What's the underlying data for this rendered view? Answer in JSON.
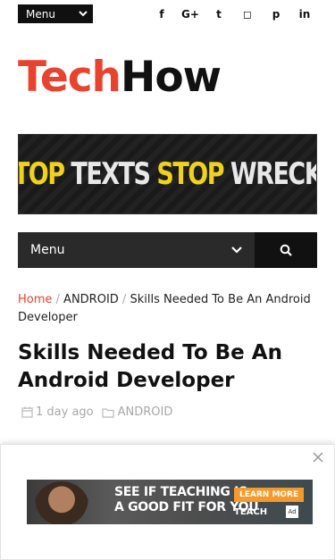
{
  "top_menu": {
    "label": "Menu"
  },
  "social": [
    {
      "icon": "facebook-icon",
      "glyph": "f"
    },
    {
      "icon": "google-plus-icon",
      "glyph": "G+"
    },
    {
      "icon": "twitter-icon",
      "glyph": "t"
    },
    {
      "icon": "instagram-icon",
      "glyph": "◻"
    },
    {
      "icon": "pinterest-icon",
      "glyph": "p"
    },
    {
      "icon": "linkedin-icon",
      "glyph": "in"
    }
  ],
  "logo": {
    "part1": "Tech",
    "part2": "How",
    "accent": "#e8432e"
  },
  "banner": {
    "word1": "STOP ",
    "word2": "TEXTS ",
    "word3": "STOP ",
    "word4": "WRECKS"
  },
  "nav": {
    "label": "Menu"
  },
  "breadcrumb": {
    "home": "Home",
    "sep": " / ",
    "category": "ANDROID",
    "current": "Skills Needed To Be An Android Developer"
  },
  "article": {
    "title": "Skills Needed To Be An Android Developer",
    "date": "1 day ago",
    "category": "ANDROID"
  },
  "ad": {
    "headline": "SEE IF TEACHING IS\nA GOOD FIT FOR YOU",
    "cta": "LEARN MORE",
    "brand": "TEACH",
    "badge": "Ad"
  }
}
